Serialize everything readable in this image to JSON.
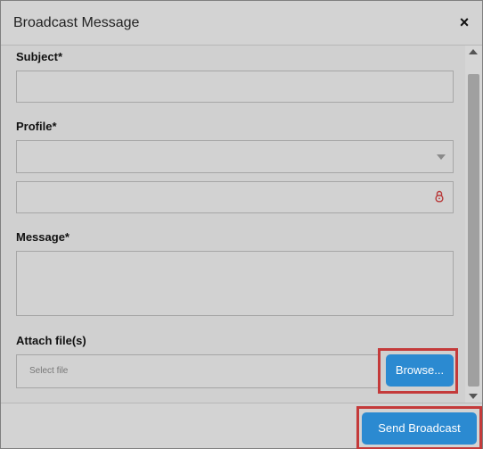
{
  "dialog": {
    "title": "Broadcast Message",
    "close_icon": "×"
  },
  "form": {
    "subject_label": "Subject*",
    "subject_value": "",
    "profile_label": "Profile*",
    "profile_value": "",
    "secure_field_value": "",
    "message_label": "Message*",
    "message_value": "",
    "attach_label": "Attach file(s)",
    "file_placeholder": "Select file",
    "browse_label": "Browse..."
  },
  "footer": {
    "send_label": "Send Broadcast"
  },
  "colors": {
    "accent": "#2b8ad1",
    "highlight": "#c43a3a",
    "lock_icon": "#b83a3a"
  },
  "icons": [
    "close-icon",
    "chevron-down-icon",
    "lock-icon",
    "scroll-up-icon",
    "scroll-down-icon"
  ]
}
